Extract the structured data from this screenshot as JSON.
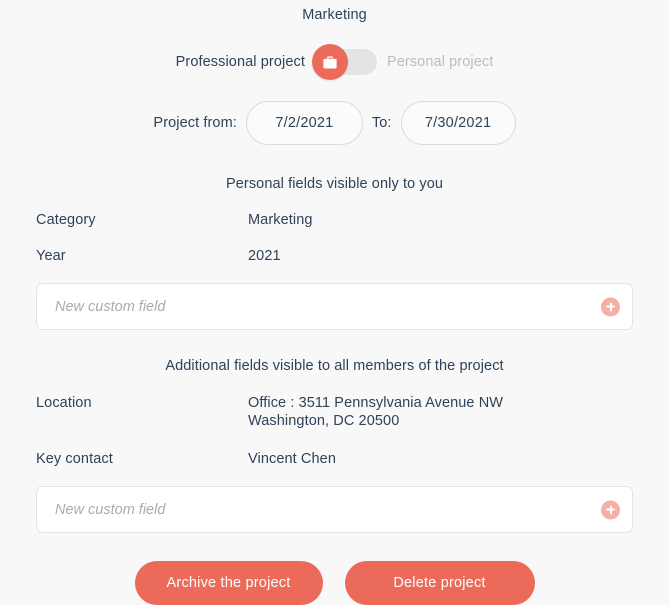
{
  "project": {
    "title": "Marketing"
  },
  "project_type_toggle": {
    "professional_label": "Professional project",
    "personal_label": "Personal project",
    "selected": "professional",
    "knob_icon": "briefcase-icon",
    "knob_color": "#ec6a5a",
    "track_color": "#e4e4e4",
    "inactive_label_color": "#b9bcc1"
  },
  "dates": {
    "from_label": "Project from:",
    "from_value": "7/2/2021",
    "to_label": "To:",
    "to_value": "7/30/2021"
  },
  "personal_section": {
    "header": "Personal fields visible only to you",
    "fields": [
      {
        "label": "Category",
        "value": "Marketing"
      },
      {
        "label": "Year",
        "value": "2021"
      }
    ],
    "new_field_placeholder": "New custom field",
    "new_field_value": "",
    "add_icon": "plus-icon"
  },
  "additional_section": {
    "header": "Additional fields visible to all members of the project",
    "fields": [
      {
        "label": "Location",
        "value": "Office : 3511 Pennsylvania Avenue NW\nWashington, DC 20500"
      },
      {
        "label": "Key contact",
        "value": "Vincent Chen"
      }
    ],
    "new_field_placeholder": "New custom field",
    "new_field_value": "",
    "add_icon": "plus-icon"
  },
  "actions": {
    "archive_label": "Archive the project",
    "delete_label": "Delete project",
    "button_color": "#ec6a5a"
  },
  "theme": {
    "background": "#f8f8f8",
    "accent": "#ec6a5a",
    "accent_light": "#f4b0a7",
    "text": "#2f4258",
    "muted": "#a8abb0",
    "border": "#e2e4e7"
  }
}
